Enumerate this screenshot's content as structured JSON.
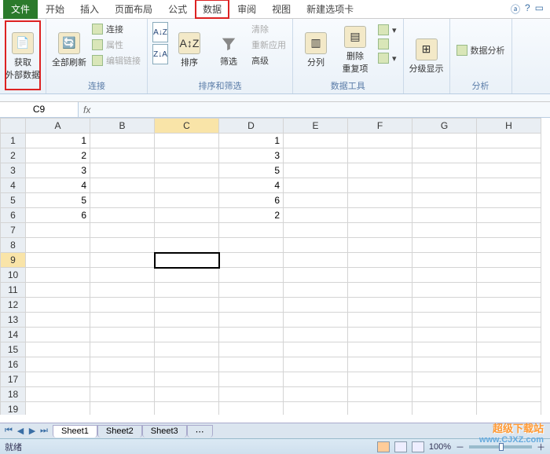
{
  "tabs": {
    "file": "文件",
    "home": "开始",
    "insert": "插入",
    "layout": "页面布局",
    "formula": "公式",
    "data": "数据",
    "review": "审阅",
    "view": "视图",
    "newtab": "新建选项卡"
  },
  "ribbon": {
    "external": {
      "label": "获取\n外部数据"
    },
    "refresh": {
      "label": "全部刷新",
      "connections": "连接",
      "properties": "属性",
      "editlinks": "编辑链接",
      "group": "连接"
    },
    "sort": {
      "asc": "A↓Z",
      "desc": "Z↓A",
      "sort": "排序",
      "filter": "筛选",
      "clear": "清除",
      "reapply": "重新应用",
      "advanced": "高级",
      "group": "排序和筛选"
    },
    "tools": {
      "split": "分列",
      "dup": "删除\n重复项",
      "group": "数据工具"
    },
    "outline": {
      "label": "分级显示"
    },
    "analysis": {
      "label": "数据分析",
      "group": "分析"
    }
  },
  "namebox": "C9",
  "columns": [
    "A",
    "B",
    "C",
    "D",
    "E",
    "F",
    "G",
    "H"
  ],
  "rows": 19,
  "data": {
    "A": {
      "1": "1",
      "2": "2",
      "3": "3",
      "4": "4",
      "5": "5",
      "6": "6"
    },
    "D": {
      "1": "1",
      "2": "3",
      "3": "5",
      "4": "4",
      "5": "6",
      "6": "2"
    }
  },
  "selected": {
    "col": "C",
    "row": 9
  },
  "sheets": [
    "Sheet1",
    "Sheet2",
    "Sheet3"
  ],
  "status": "就绪",
  "zoom": "100%",
  "watermark": {
    "l1": "超级下载站",
    "l2": "www.CJXZ.com"
  }
}
